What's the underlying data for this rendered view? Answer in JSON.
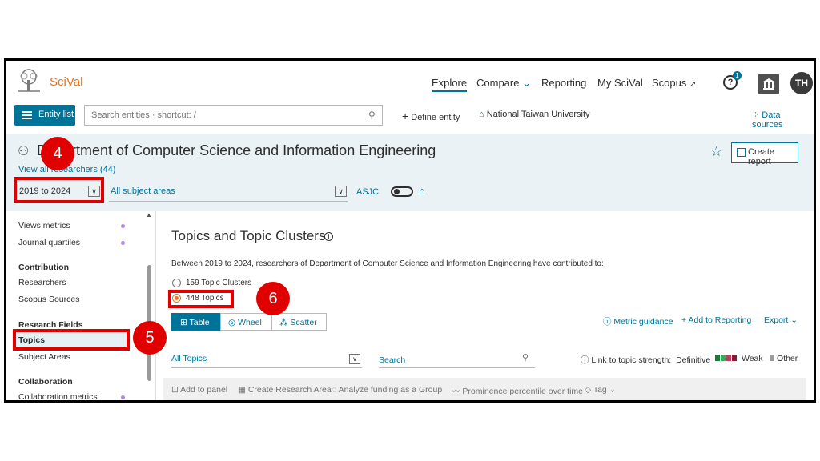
{
  "app": {
    "name": "SciVal"
  },
  "topnav": {
    "explore": "Explore",
    "compare": "Compare",
    "reporting": "Reporting",
    "my_scival": "My SciVal",
    "scopus": "Scopus",
    "help_badge": "1",
    "avatar": "TH"
  },
  "toolbar": {
    "entity_list": "Entity list",
    "search_placeholder": "Search entities · shortcut: /",
    "define_entity": "Define entity",
    "institution": "National Taiwan University",
    "data_sources": "Data sources"
  },
  "header": {
    "title": "Department of Computer Science and Information Engineering",
    "view_all": "View all researchers (44)",
    "create_report": "Create report",
    "year_range": "2019 to 2024",
    "subject_areas": "All subject areas",
    "asjc": "ASJC"
  },
  "sidebar": {
    "items": [
      {
        "label": "Views metrics",
        "dot": true
      },
      {
        "label": "Journal quartiles",
        "dot": true
      },
      {
        "label": "Contribution",
        "heading": true
      },
      {
        "label": "Researchers"
      },
      {
        "label": "Scopus Sources"
      },
      {
        "label": "Research Fields",
        "heading": true
      },
      {
        "label": "Topics",
        "active": true
      },
      {
        "label": "Subject Areas"
      },
      {
        "label": "Collaboration",
        "heading": true
      },
      {
        "label": "Collaboration metrics",
        "dot": true
      }
    ]
  },
  "main": {
    "title": "Topics and Topic Clusters",
    "description": "Between 2019 to 2024, researchers of Department of Computer Science and Information Engineering have contributed to:",
    "radio_clusters": "159 Topic Clusters",
    "radio_topics": "448 Topics",
    "tab_table": "Table",
    "tab_wheel": "Wheel",
    "tab_scatter": "Scatter",
    "metric_guidance": "Metric guidance",
    "add_reporting": "Add to Reporting",
    "export": "Export",
    "filter": "All Topics",
    "search": "Search",
    "strength_label": "Link to topic strength:",
    "strength_def": "Definitive",
    "strength_weak": "Weak",
    "strength_other": "Other"
  },
  "actions": {
    "add_panel": "Add to panel",
    "create_area": "Create Research Area",
    "analyze_funding": "Analyze funding as a Group",
    "prominence": "Prominence percentile over time",
    "tag": "Tag"
  },
  "annotations": {
    "a4": "4",
    "a5": "5",
    "a6": "6"
  },
  "colors": {
    "accent": "#007398",
    "brand": "#e9711c",
    "annotation": "#e00000"
  }
}
